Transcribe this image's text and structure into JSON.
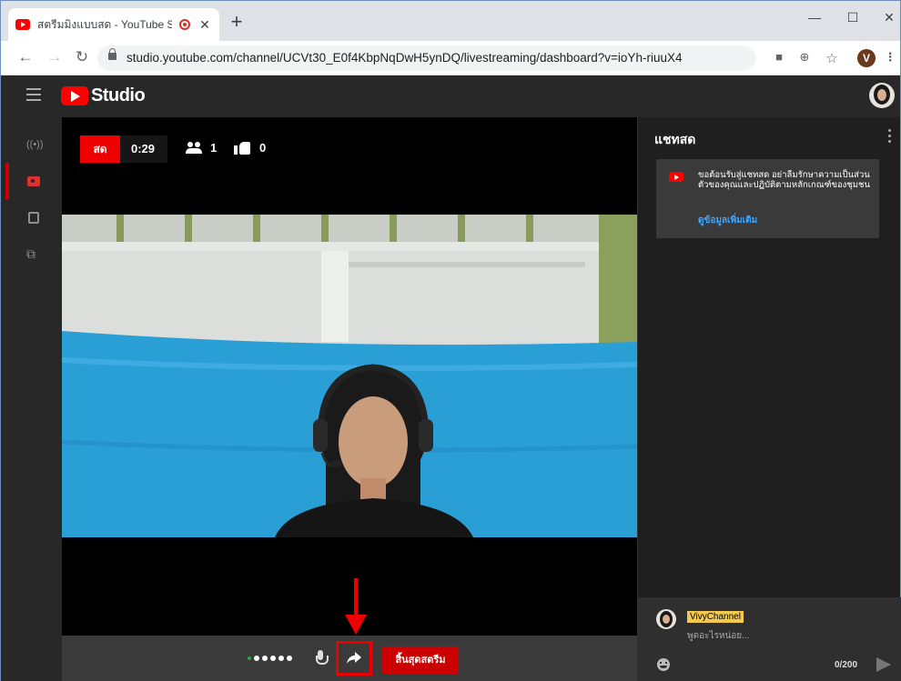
{
  "browser": {
    "tab_title": "สตรีมมิงแบบสด - YouTube Stuc",
    "tab_close": "✕",
    "new_tab": "+",
    "url": "studio.youtube.com/channel/UCVt30_E0f4KbpNqDwH5ynDQ/livestreaming/dashboard?v=ioYh-riuuX4",
    "profile_initial": "V",
    "window_controls": {
      "minimize": "—",
      "maximize": "☐",
      "close": "✕"
    }
  },
  "studio": {
    "logo_text": "Studio",
    "nav_items": [
      {
        "icon": "broadcast-icon",
        "label": "((•))"
      },
      {
        "icon": "camera-icon"
      },
      {
        "icon": "calendar-icon"
      },
      {
        "icon": "encoder-icon"
      }
    ]
  },
  "stream": {
    "live_label": "สด",
    "elapsed": "0:29",
    "viewers": "1",
    "likes": "0",
    "end_button": "สิ้นสุดสตรีม"
  },
  "chat": {
    "title": "แชทสด",
    "welcome_message": "ขอต้อนรับสู่แชทสด อย่าลืมรักษาความเป็นส่วนตัวของคุณและปฏิบัติตามหลักเกณฑ์ของชุมชน",
    "learn_more": "ดูข้อมูลเพิ่มเติม",
    "username": "VivyChannel",
    "input_placeholder": "พูดอะไรหน่อย...",
    "char_counter": "0/200"
  },
  "colors": {
    "accent_red": "#ff0000",
    "link_blue": "#3ea6ff",
    "name_highlight": "#f2c94c"
  }
}
